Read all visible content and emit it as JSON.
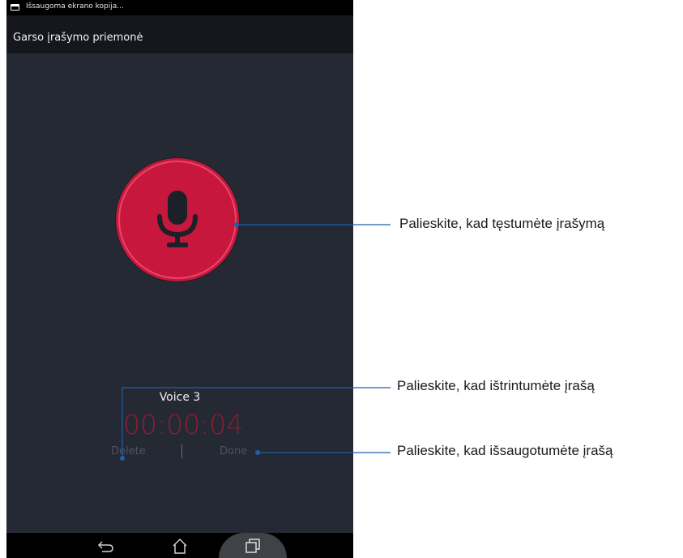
{
  "status_bar": {
    "notification_text": "Išsaugoma ekrano kopija..."
  },
  "app_bar": {
    "title": "Garso įrašymo priemonė"
  },
  "recorder": {
    "file_name": "Voice 3",
    "elapsed_time": "00:00:04",
    "delete_label": "Delete",
    "done_label": "Done"
  },
  "callouts": {
    "continue": "Palieskite, kad tęstumėte įrašymą",
    "delete": "Palieskite, kad ištrintumėte įrašą",
    "save": "Palieskite, kad išsaugotumėte įrašą"
  },
  "colors": {
    "background": "#242933",
    "record_button": "#c7173c",
    "timer": "#8c1d33",
    "leader_line": "#1f5fa8"
  }
}
